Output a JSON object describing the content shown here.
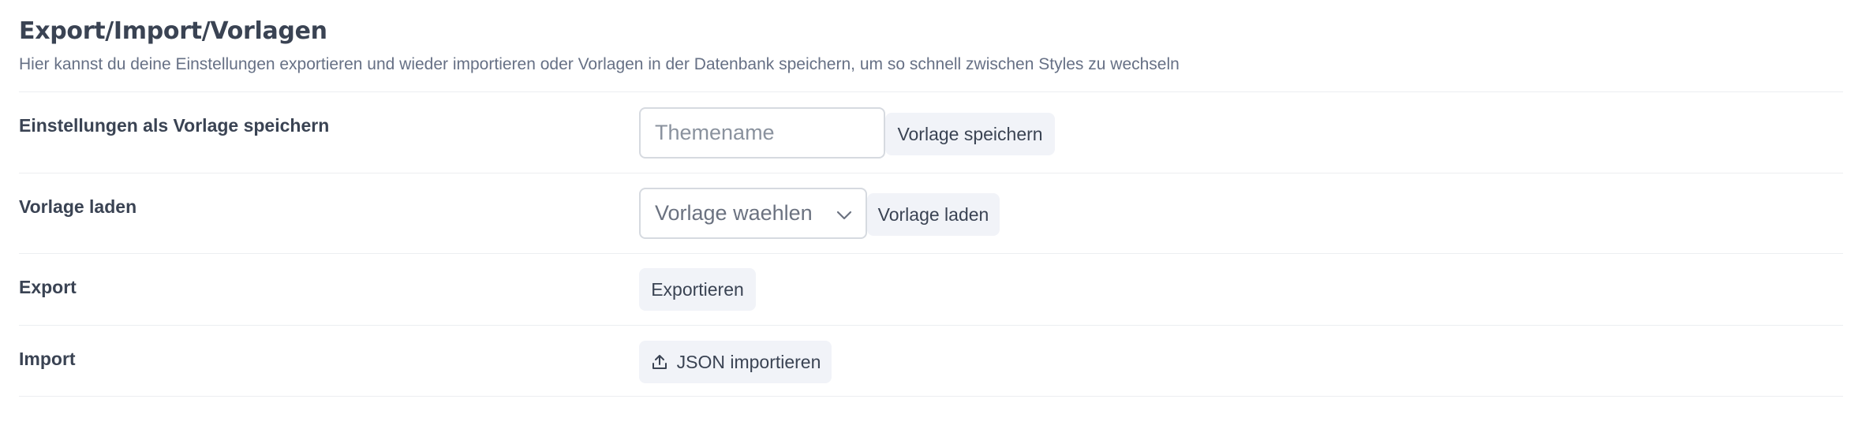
{
  "header": {
    "title": "Export/Import/Vorlagen",
    "subtitle": "Hier kannst du deine Einstellungen exportieren und wieder importieren oder Vorlagen in der Datenbank speichern, um so schnell zwischen Styles zu wechseln"
  },
  "rows": {
    "save_template": {
      "label": "Einstellungen als Vorlage speichern",
      "input_placeholder": "Themename",
      "input_value": "",
      "button_label": "Vorlage speichern"
    },
    "load_template": {
      "label": "Vorlage laden",
      "select_value": "Vorlage waehlen",
      "select_icon": "chevron-down-icon",
      "button_label": "Vorlage laden"
    },
    "export": {
      "label": "Export",
      "button_label": "Exportieren"
    },
    "import": {
      "label": "Import",
      "button_icon": "upload-icon",
      "button_label": "JSON importieren"
    }
  },
  "colors": {
    "text_primary": "#3a4353",
    "text_muted": "#667085",
    "button_bg": "#f1f3f8",
    "border": "#d6dae0",
    "divider": "#eceef1"
  }
}
